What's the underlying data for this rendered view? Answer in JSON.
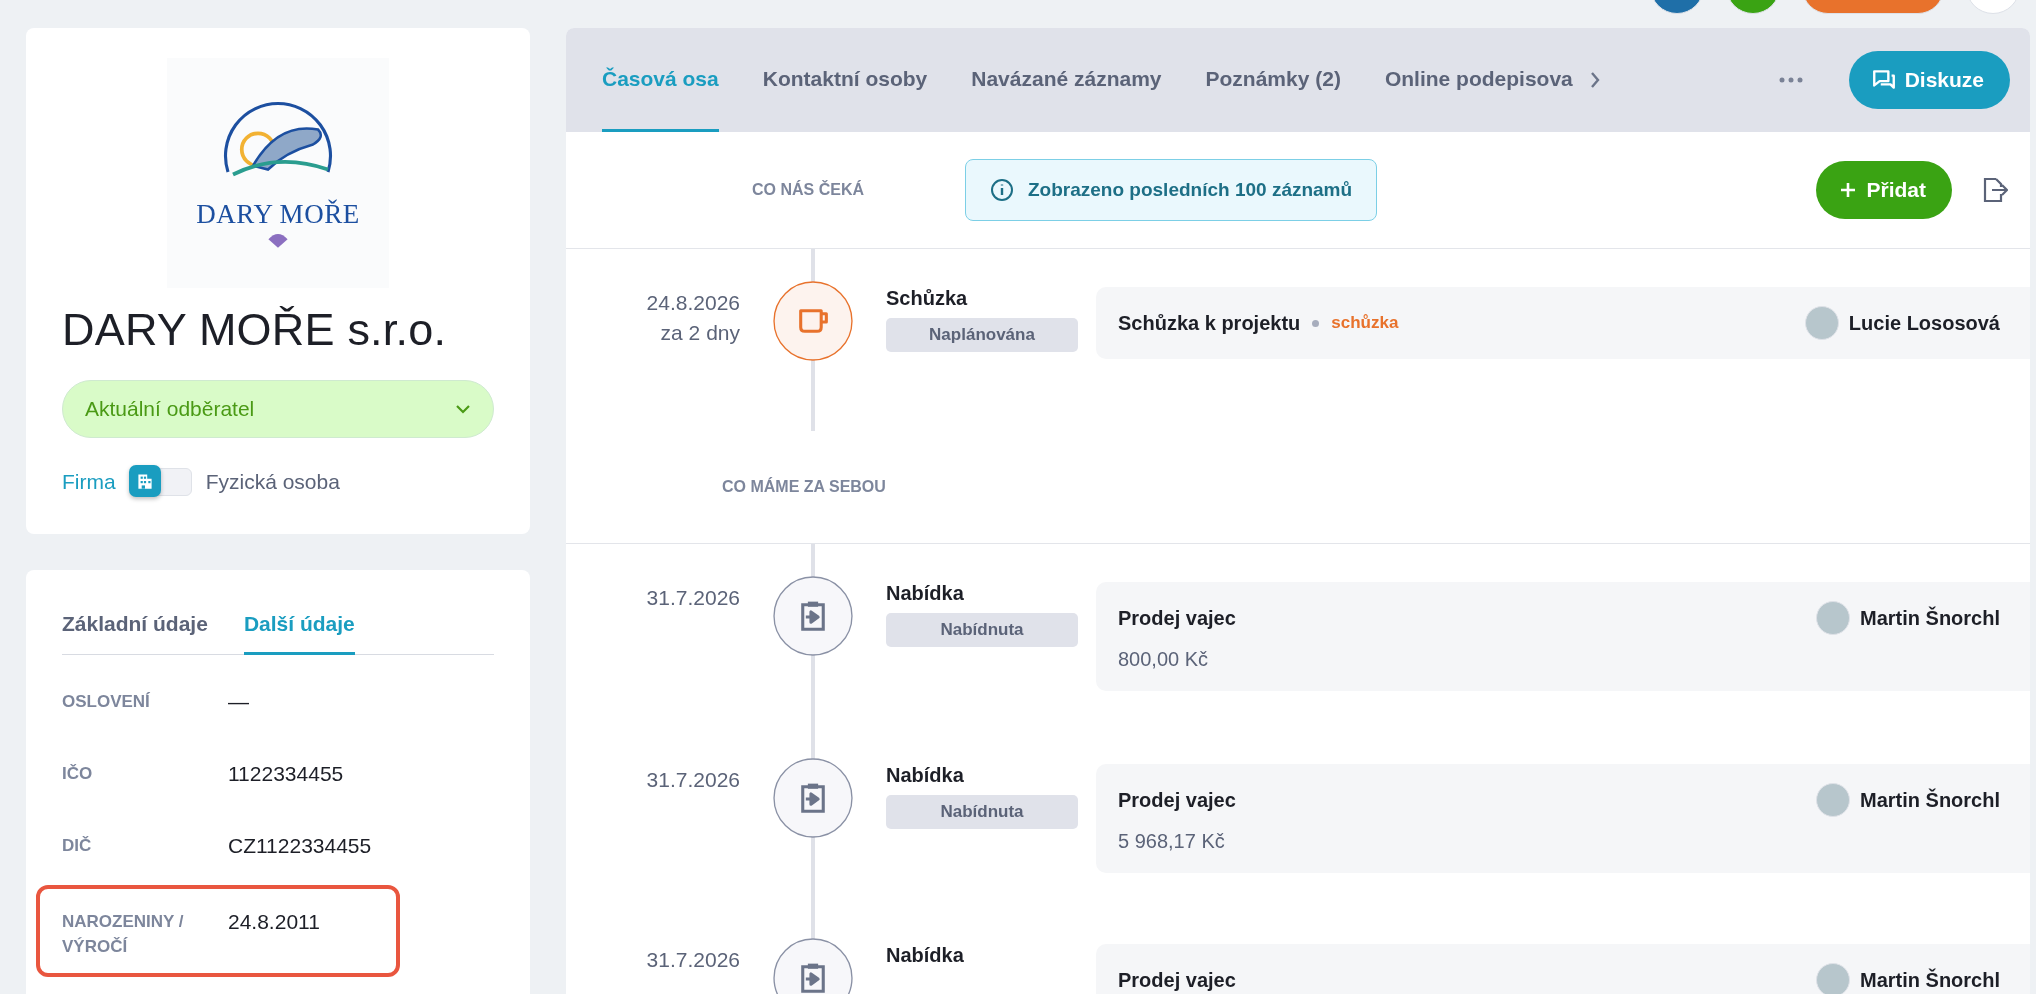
{
  "header_avatars": [
    {
      "kind": "circle",
      "color": "#1f6fa8"
    },
    {
      "kind": "circle",
      "color": "#3aa313"
    },
    {
      "kind": "pill",
      "color": "#e8722c"
    },
    {
      "kind": "circle",
      "color": "#ffffff"
    }
  ],
  "company": {
    "logo_text": "DARY MOŘE",
    "name": "DARY MOŘE s.r.o.",
    "status": "Aktuální odběratel",
    "type_toggle": {
      "left": "Firma",
      "right": "Fyzická osoba",
      "on_left": true
    }
  },
  "details": {
    "tabs": [
      {
        "label": "Základní údaje",
        "selected": false
      },
      {
        "label": "Další údaje",
        "selected": true
      }
    ],
    "rows": [
      {
        "label": "OSLOVENÍ",
        "value": "—",
        "highlighted": false
      },
      {
        "label": "IČO",
        "value": "1122334455",
        "highlighted": false
      },
      {
        "label": "DIČ",
        "value": "CZ1122334455",
        "highlighted": false
      },
      {
        "label": "NAROZENINY / VÝROČÍ",
        "value": "24.8.2011",
        "highlighted": true
      }
    ]
  },
  "main_tabs": [
    {
      "label": "Časová osa",
      "selected": true
    },
    {
      "label": "Kontaktní osoby",
      "selected": false
    },
    {
      "label": "Navázané záznamy",
      "selected": false
    },
    {
      "label": "Poznámky (2)",
      "selected": false
    },
    {
      "label": "Online podepisova",
      "selected": false
    }
  ],
  "discussion_button": "Diskuze",
  "info_banner": "Zobrazeno posledních 100 záznamů",
  "add_button": "Přidat",
  "sections": [
    {
      "title": "CO NÁS ČEKÁ",
      "events": [
        {
          "date": "24.8.2026",
          "relative": "za 2 dny",
          "kind": "meeting",
          "type": "Schůzka",
          "status": "Naplánována",
          "title": "Schůzka k projektu",
          "tag": "schůzka",
          "person": "Lucie Lososová"
        }
      ]
    },
    {
      "title": "CO MÁME ZA SEBOU",
      "events": [
        {
          "date": "31.7.2026",
          "kind": "offer",
          "type": "Nabídka",
          "status": "Nabídnuta",
          "title": "Prodej vajec",
          "amount": "800,00 Kč",
          "person": "Martin Šnorchl"
        },
        {
          "date": "31.7.2026",
          "kind": "offer",
          "type": "Nabídka",
          "status": "Nabídnuta",
          "title": "Prodej vajec",
          "amount": "5 968,17 Kč",
          "person": "Martin Šnorchl"
        },
        {
          "date": "31.7.2026",
          "kind": "offer",
          "type": "Nabídka",
          "title": "Prodej vajec",
          "person": "Martin Šnorchl"
        }
      ]
    }
  ]
}
